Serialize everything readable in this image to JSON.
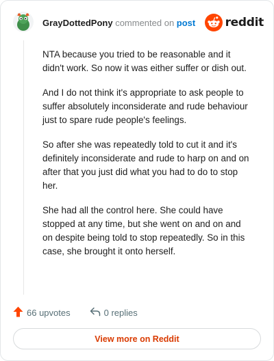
{
  "comment": {
    "author": "GrayDottedPony",
    "action_text": " commented on ",
    "target_link": "post",
    "paragraphs": [
      "NTA because you tried to be reasonable and it didn't work. So now it was either suffer or dish out.",
      "And I do not think it's appropriate to ask people to suffer absolutely inconsiderate and rude behaviour just to spare rude people's feelings.",
      "So after she was repeatedly told to cut it and it's definitely inconsiderate and rude to harp on and on after that you just did what you had to do to stop her.",
      "She had all the control here. She could have stopped at any time, but she went on and on and on despite being told to stop repeatedly. So in this case, she brought it onto herself."
    ]
  },
  "brand": {
    "name": "reddit",
    "icon": "reddit-alien-icon",
    "color": "#ff4500"
  },
  "actions": {
    "upvotes_label": "66 upvotes",
    "replies_label": "0 replies"
  },
  "footer": {
    "view_more_label": "View more on Reddit"
  },
  "colors": {
    "upvote": "#ff4500",
    "link": "#0079d3",
    "view_more_text": "#d93a00"
  }
}
